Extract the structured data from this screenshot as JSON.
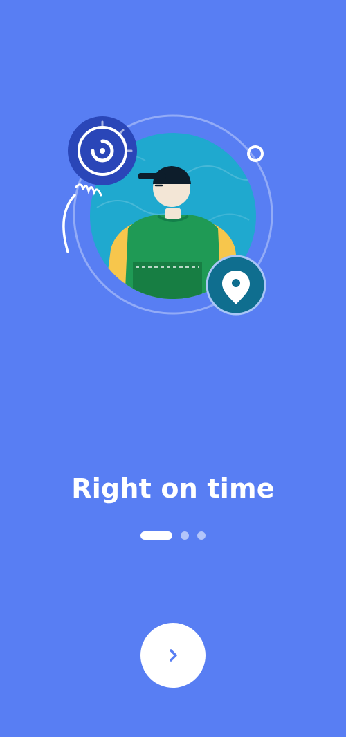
{
  "onboarding": {
    "title": "Right on time",
    "page_count": 3,
    "current_page": 1,
    "accent_color": "#587EF3"
  },
  "next_button": {
    "icon": "chevron-right-icon"
  }
}
